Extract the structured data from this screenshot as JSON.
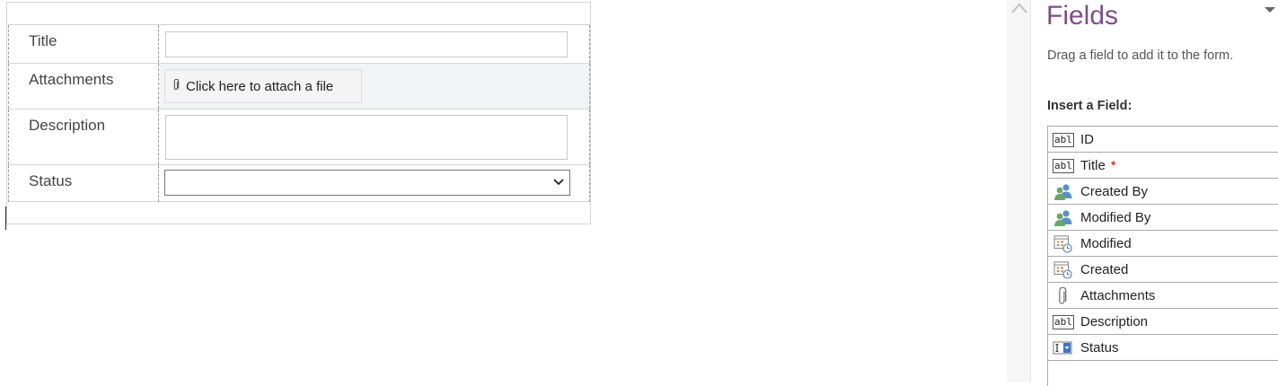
{
  "form": {
    "rows": [
      {
        "label": "Title",
        "control": "text"
      },
      {
        "label": "Attachments",
        "control": "attach",
        "button_text": "Click here to attach a file"
      },
      {
        "label": "Description",
        "control": "textarea"
      },
      {
        "label": "Status",
        "control": "select",
        "selected": ""
      }
    ]
  },
  "panel": {
    "title": "Fields",
    "hint": "Drag a field to add it to the form.",
    "insert_label": "Insert a Field:",
    "required_marker": "*",
    "fields": [
      {
        "name": "ID",
        "icon": "text-field-icon",
        "required": false
      },
      {
        "name": "Title",
        "icon": "text-field-icon",
        "required": true
      },
      {
        "name": "Created By",
        "icon": "people-icon",
        "required": false
      },
      {
        "name": "Modified By",
        "icon": "people-icon",
        "required": false
      },
      {
        "name": "Modified",
        "icon": "date-time-icon",
        "required": false
      },
      {
        "name": "Created",
        "icon": "date-time-icon",
        "required": false
      },
      {
        "name": "Attachments",
        "icon": "paperclip-icon",
        "required": false
      },
      {
        "name": "Description",
        "icon": "text-field-icon",
        "required": false
      },
      {
        "name": "Status",
        "icon": "choice-icon",
        "required": false
      }
    ]
  },
  "colors": {
    "panel_title": "#7a4f8a",
    "required": "#cc0000"
  }
}
